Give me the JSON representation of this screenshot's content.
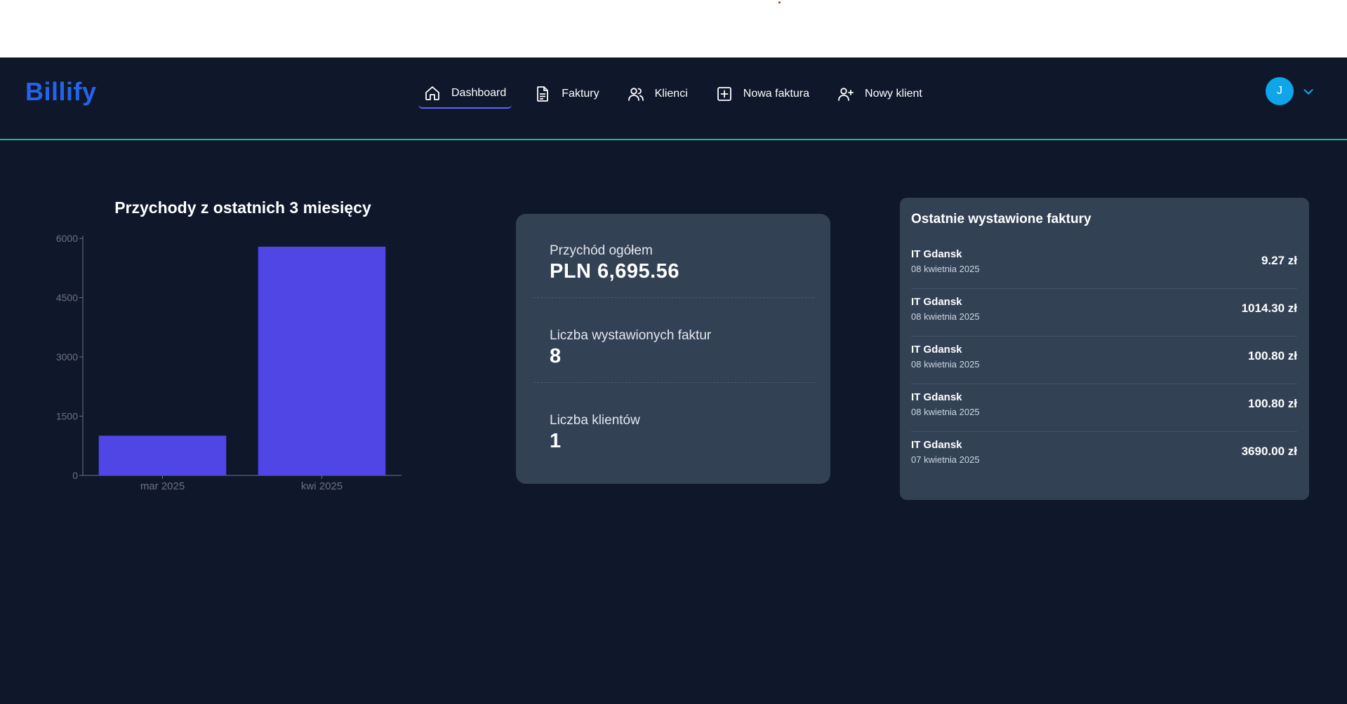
{
  "app": {
    "logo": "Billify"
  },
  "nav": {
    "items": [
      {
        "label": "Dashboard",
        "icon": "home-icon",
        "active": true
      },
      {
        "label": "Faktury",
        "icon": "document-icon",
        "active": false
      },
      {
        "label": "Klienci",
        "icon": "users-icon",
        "active": false
      },
      {
        "label": "Nowa faktura",
        "icon": "plus-square-icon",
        "active": false
      },
      {
        "label": "Nowy klient",
        "icon": "user-plus-icon",
        "active": false
      }
    ]
  },
  "user": {
    "initial": "J"
  },
  "colors": {
    "background": "#0f172a",
    "card": "#334155",
    "accent": "#2563eb",
    "bar": "#4f46e5",
    "divider": "#14b8a6",
    "avatar": "#0ea5e9"
  },
  "chart_data": {
    "type": "bar",
    "title": "Przychody z ostatnich 3 miesięcy",
    "categories": [
      "mar 2025",
      "kwi 2025"
    ],
    "values": [
      1005.2,
      5790.36
    ],
    "yticks": [
      0,
      1500,
      3000,
      4500,
      6000
    ],
    "ylim": [
      0,
      6000
    ],
    "xlabel": "",
    "ylabel": "",
    "grid": false
  },
  "stats": [
    {
      "label": "Przychód ogółem",
      "value": "PLN 6,695.56"
    },
    {
      "label": "Liczba wystawionych faktur",
      "value": "8"
    },
    {
      "label": "Liczba klientów",
      "value": "1"
    }
  ],
  "recent": {
    "title": "Ostatnie wystawione faktury",
    "items": [
      {
        "client": "IT Gdansk",
        "date": "08 kwietnia 2025",
        "amount": "9.27 zł"
      },
      {
        "client": "IT Gdansk",
        "date": "08 kwietnia 2025",
        "amount": "1014.30 zł"
      },
      {
        "client": "IT Gdansk",
        "date": "08 kwietnia 2025",
        "amount": "100.80 zł"
      },
      {
        "client": "IT Gdansk",
        "date": "08 kwietnia 2025",
        "amount": "100.80 zł"
      },
      {
        "client": "IT Gdansk",
        "date": "07 kwietnia 2025",
        "amount": "3690.00 zł"
      }
    ]
  }
}
